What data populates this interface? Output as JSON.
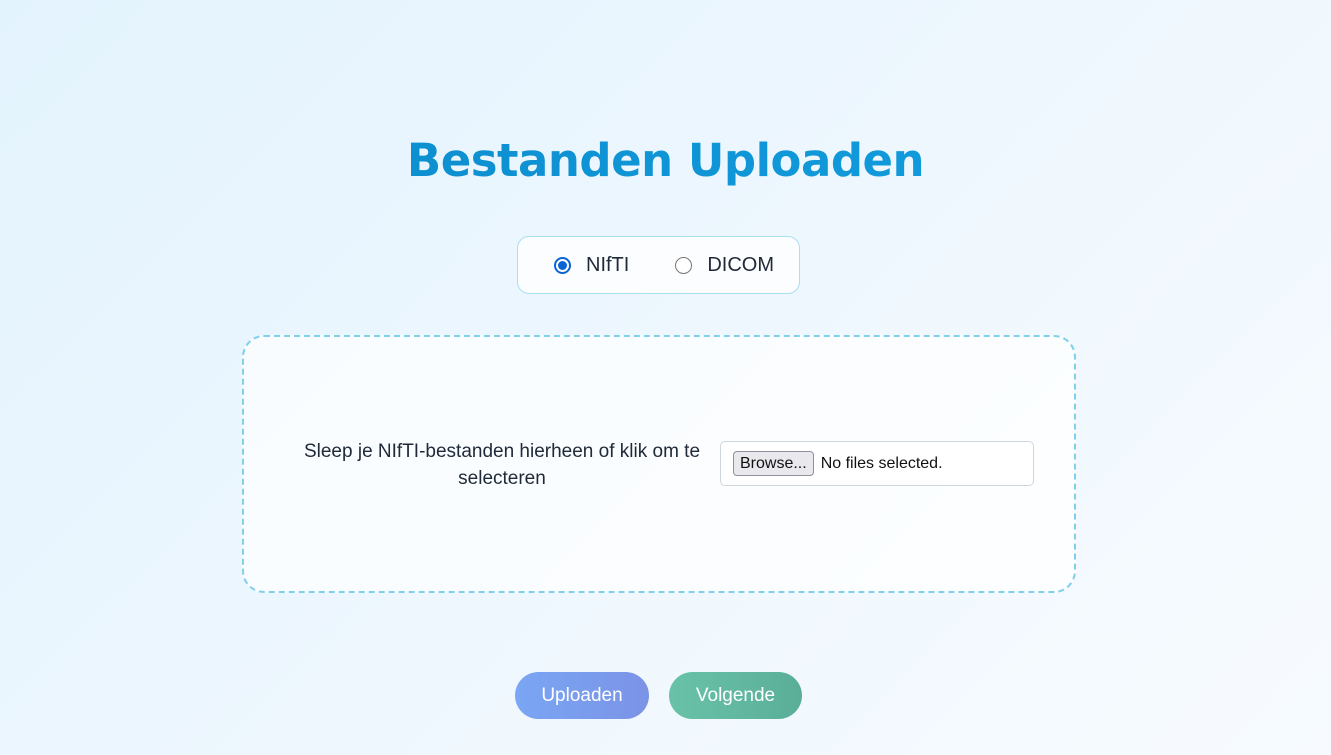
{
  "page": {
    "title": "Bestanden Uploaden"
  },
  "format_selector": {
    "options": [
      {
        "label": "NIfTI",
        "checked": true
      },
      {
        "label": "DICOM",
        "checked": false
      }
    ]
  },
  "dropzone": {
    "instruction": "Sleep je NIfTI-bestanden hierheen of klik om te selecteren",
    "file_input": {
      "button_label": "Browse...",
      "status": "No files selected."
    }
  },
  "actions": {
    "upload_label": "Uploaden",
    "next_label": "Volgende"
  },
  "colors": {
    "title": "#0b8fce",
    "radio_accent": "#0a64d6",
    "dropzone_border": "#7fd0ea",
    "upload_button": "#7aa6f3",
    "next_button": "#69c2a8"
  }
}
